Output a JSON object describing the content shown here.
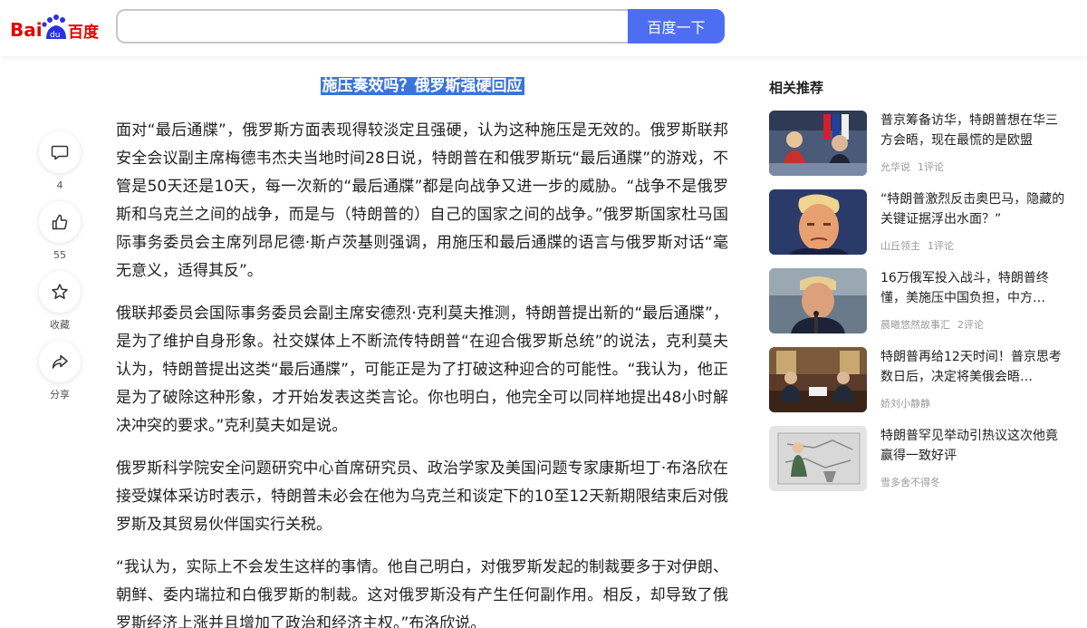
{
  "header": {
    "logo_text": "Bai du 百度",
    "search_value": "",
    "search_button": "百度一下"
  },
  "actions": {
    "comment_count": "4",
    "like_count": "55",
    "favorite_label": "收藏",
    "share_label": "分享"
  },
  "article": {
    "title": "施压奏效吗？俄罗斯强硬回应",
    "paragraphs": [
      "面对“最后通牒”，俄罗斯方面表现得较淡定且强硬，认为这种施压是无效的。俄罗斯联邦安全会议副主席梅德韦杰夫当地时间28日说，特朗普在和俄罗斯玩“最后通牒”的游戏，不管是50天还是10天，每一次新的“最后通牒”都是向战争又进一步的威胁。“战争不是俄罗斯和乌克兰之间的战争，而是与（特朗普的）自己的国家之间的战争。”俄罗斯国家杜马国际事务委员会主席列昂尼德·斯卢茨基则强调，用施压和最后通牒的语言与俄罗斯对话“毫无意义，适得其反”。",
      "俄联邦委员会国际事务委员会副主席安德烈·克利莫夫推测，特朗普提出新的“最后通牒”，是为了维护自身形象。社交媒体上不断流传特朗普“在迎合俄罗斯总统”的说法，克利莫夫认为，特朗普提出这类“最后通牒”，可能正是为了打破这种迎合的可能性。“我认为，他正是为了破除这种形象，才开始发表这类言论。你也明白，他完全可以同样地提出48小时解决冲突的要求。”克利莫夫如是说。",
      "俄罗斯科学院安全问题研究中心首席研究员、政治学家及美国问题专家康斯坦丁·布洛欣在接受媒体采访时表示，特朗普未必会在他为乌克兰和谈定下的10至12天新期限结束后对俄罗斯及其贸易伙伴国实行关税。",
      "“我认为，实际上不会发生这样的事情。他自己明白，对俄罗斯发起的制裁要多于对伊朗、朝鲜、委内瑞拉和白俄罗斯的制裁。这对俄罗斯没有产生任何副作用。相反，却导致了俄罗斯经济上涨并且增加了政治和经济主权。”布洛欣说。"
    ]
  },
  "related": {
    "title": "相关推荐",
    "items": [
      {
        "headline": "普京筹备访华，特朗普想在华三方会晤，现在最慌的是欧盟",
        "source": "允华说",
        "comments": "1评论"
      },
      {
        "headline": "“特朗普激烈反击奥巴马，隐藏的关键证据浮出水面？”",
        "source": "山丘领主",
        "comments": "1评论"
      },
      {
        "headline": "16万俄军投入战斗，特朗普终懂，美施压中国负担，中方…",
        "source": "晨曦悠然故事汇",
        "comments": "2评论"
      },
      {
        "headline": "特朗普再给12天时间！普京思考数日后，决定将美俄会晤…",
        "source": "娇刘小静静",
        "comments": ""
      },
      {
        "headline": "特朗普罕见举动引热议这次他竟赢得一致好评",
        "source": "雪多舍不得冬",
        "comments": ""
      }
    ]
  },
  "colors": {
    "accent": "#4e6ef2",
    "logo_red": "#e10602",
    "logo_blue": "#2932e1",
    "highlight": "#3a76d9"
  }
}
